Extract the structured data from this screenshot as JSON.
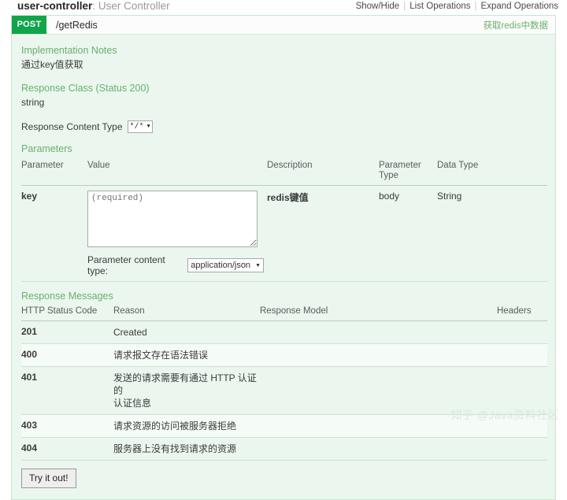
{
  "resource": {
    "name": "user-controller",
    "separator": ":",
    "title": "User Controller",
    "options": {
      "show_hide": "Show/Hide",
      "list_operations": "List Operations",
      "expand_operations": "Expand Operations",
      "divider": "|"
    }
  },
  "operation": {
    "method": "POST",
    "path": "/getRedis",
    "summary": "获取redis中数据",
    "implementation_notes_label": "Implementation Notes",
    "implementation_notes": "通过key值获取",
    "response_class_label": "Response Class (Status 200)",
    "response_class_value": "string",
    "response_content_type_label": "Response Content Type",
    "response_content_type_value": "*/*",
    "caret": "▼"
  },
  "parameters": {
    "section_label": "Parameters",
    "headers": [
      "Parameter",
      "Value",
      "Description",
      "Parameter Type",
      "Data Type"
    ],
    "header_parameter": "Parameter",
    "header_value": "Value",
    "header_description": "Description",
    "header_parameter_type_line1": "Parameter",
    "header_parameter_type_line2": "Type",
    "header_data_type": "Data Type",
    "rows": [
      {
        "name": "key",
        "value_placeholder": "(required)",
        "value": "",
        "description": "redis键值",
        "parameter_type": "body",
        "data_type": "String"
      }
    ],
    "content_type_label": "Parameter content type:",
    "content_type_value": "application/json"
  },
  "response_messages": {
    "section_label": "Response Messages",
    "header_status_code": "HTTP Status Code",
    "header_reason": "Reason",
    "header_response_model": "Response Model",
    "header_headers": "Headers",
    "rows": [
      {
        "code": "201",
        "reason": "Created",
        "reason_line2": "",
        "model": "",
        "headers": ""
      },
      {
        "code": "400",
        "reason": "请求报文存在语法错误",
        "reason_line2": "",
        "model": "",
        "headers": ""
      },
      {
        "code": "401",
        "reason": "发送的请求需要有通过 HTTP 认证的",
        "reason_line2": "认证信息",
        "model": "",
        "headers": ""
      },
      {
        "code": "403",
        "reason": "请求资源的访问被服务器拒绝",
        "reason_line2": "",
        "model": "",
        "headers": ""
      },
      {
        "code": "404",
        "reason": "服务器上没有找到请求的资源",
        "reason_line2": "",
        "model": "",
        "headers": ""
      }
    ]
  },
  "actions": {
    "try_it_out": "Try it out!"
  },
  "watermark": {
    "text": "知乎 @Java资料社区"
  },
  "colors": {
    "method_post": "#10a54a",
    "panel_bg": "#eaf6ee",
    "panel_border": "#c8e6cd",
    "accent_text": "#6ab06e"
  }
}
